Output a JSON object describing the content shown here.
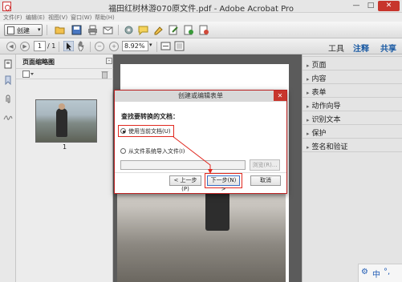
{
  "window": {
    "title": "福田红树林游070原文件.pdf - Adobe Acrobat Pro",
    "min": "—",
    "max": "□",
    "close": "✕"
  },
  "menubar": {
    "items": [
      "文件(F)",
      "编辑(E)",
      "视图(V)",
      "窗口(W)",
      "帮助(H)"
    ]
  },
  "toolbar": {
    "create_label": "创建",
    "create_arrow": "▾",
    "page_current": "1",
    "page_total": "/ 1",
    "zoom": "8.92%",
    "zoom_arrow": "▾",
    "prev": "◀",
    "next": "▶",
    "zoom_out": "−",
    "zoom_in": "+",
    "tools": "工具",
    "comment": "注释",
    "share": "共享"
  },
  "thumbnails": {
    "title": "页面缩略图",
    "options": "-",
    "page_number": "1"
  },
  "right_panel": {
    "items": [
      "页面",
      "内容",
      "表单",
      "动作向导",
      "识别文本",
      "保护",
      "签名和验证"
    ]
  },
  "dialog": {
    "title": "创建或编辑表单",
    "close": "✕",
    "heading": "查找要转换的文档：",
    "option_current": "使用当前文档(U)",
    "option_import": "从文件系统导入文件(I)",
    "browse": "浏览(R)...",
    "back": "< 上一步(P)",
    "next": "下一步(N) >",
    "cancel": "取消"
  },
  "ime": {
    "mode": "中",
    "punct": "°,",
    "icon": "⚙"
  },
  "colors": {
    "accent_red": "#e0281f",
    "link_blue": "#1a5aa3"
  }
}
